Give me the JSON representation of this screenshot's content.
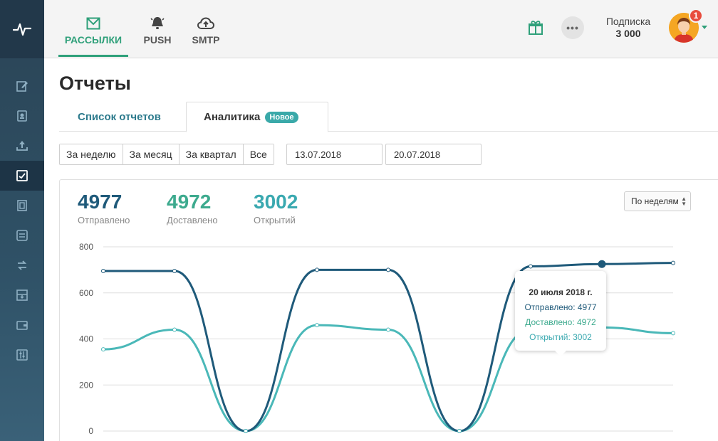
{
  "header": {
    "tabs": [
      {
        "label": "РАССЫЛКИ",
        "icon": "envelope-icon",
        "active": true
      },
      {
        "label": "PUSH",
        "icon": "bell-icon",
        "active": false
      },
      {
        "label": "SMTP",
        "icon": "cloud-upload-icon",
        "active": false
      }
    ],
    "subscription_label": "Подписка",
    "subscription_value": "3 000",
    "notification_count": "1",
    "more_label": "•••"
  },
  "sidebar": {
    "items": [
      {
        "icon": "edit-icon",
        "active": false
      },
      {
        "icon": "address-book-icon",
        "active": false
      },
      {
        "icon": "upload-icon",
        "active": false
      },
      {
        "icon": "reports-icon",
        "active": true
      },
      {
        "icon": "template-icon",
        "active": false
      },
      {
        "icon": "automation-icon",
        "active": false
      },
      {
        "icon": "exchange-icon",
        "active": false
      },
      {
        "icon": "inbox-icon",
        "active": false
      },
      {
        "icon": "wallet-icon",
        "active": false
      },
      {
        "icon": "settings-sliders-icon",
        "active": false
      }
    ]
  },
  "page": {
    "title": "Отчеты",
    "tab_list": "Список отчетов",
    "tab_analytics": "Аналитика",
    "new_badge": "Новое"
  },
  "filters": {
    "ranges": [
      "За неделю",
      "За месяц",
      "За квартал",
      "Все"
    ],
    "date_from": "13.07.2018",
    "date_to": "20.07.2018",
    "period": "По неделям"
  },
  "stats": {
    "sent_value": "4977",
    "sent_label": "Отправлено",
    "delivered_value": "4972",
    "delivered_label": "Доставлено",
    "opened_value": "3002",
    "opened_label": "Открытий"
  },
  "tooltip": {
    "title": "20 июля 2018 г.",
    "sent": "Отправлено: 4977",
    "delivered": "Доставлено: 4972",
    "opened": "Открытий: 3002"
  },
  "colors": {
    "brand_green": "#2fa07a",
    "sent": "#1f5a7a",
    "delivered": "#3aa9b0",
    "badge_red": "#e84c3d"
  },
  "chart_data": {
    "type": "line",
    "yticks": [
      "800",
      "600",
      "400",
      "200",
      "0"
    ],
    "ylim": [
      0,
      800
    ],
    "x": [
      0,
      1,
      2,
      3,
      4,
      5,
      6,
      7,
      8
    ],
    "series": [
      {
        "name": "Отправлено",
        "color": "#1f5a7a",
        "values": [
          695,
          695,
          0,
          700,
          700,
          0,
          715,
          725,
          730
        ]
      },
      {
        "name": "Доставлено",
        "color": "#4ab8b8",
        "values": [
          355,
          440,
          0,
          460,
          440,
          0,
          440,
          450,
          425
        ]
      }
    ],
    "highlight_index": 7,
    "grid": true
  }
}
